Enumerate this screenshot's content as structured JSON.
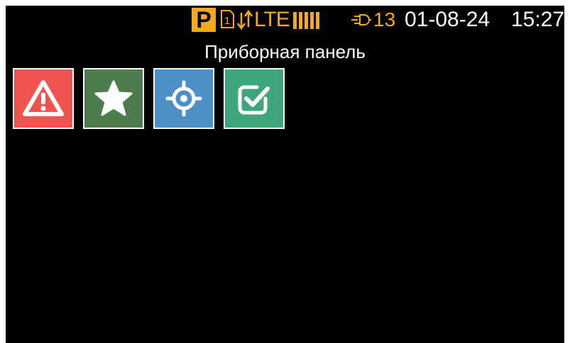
{
  "status_bar": {
    "profile_badge": "P",
    "sim_slot": "1",
    "network_type": "LTE",
    "signal_level": 5,
    "connection_count": "13",
    "date": "01-08-24",
    "time": "15:27",
    "accent_color": "#f5a623",
    "icons": [
      "sim-card-icon",
      "data-transfer-icon",
      "signal-bars-icon",
      "plug-icon"
    ]
  },
  "page": {
    "title": "Приборная панель"
  },
  "tiles": [
    {
      "name": "alert-tile",
      "icon": "warning-icon",
      "color": "#ef5350"
    },
    {
      "name": "favorites-tile",
      "icon": "star-icon",
      "color": "#4e7d4d"
    },
    {
      "name": "location-tile",
      "icon": "crosshair-icon",
      "color": "#4d8fc7"
    },
    {
      "name": "tasks-tile",
      "icon": "checkbox-icon",
      "color": "#3fa57a"
    }
  ]
}
